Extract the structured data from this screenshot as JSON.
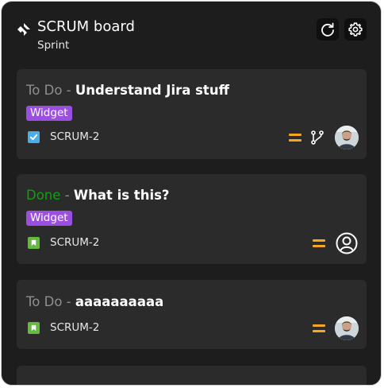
{
  "header": {
    "title": "SCRUM board",
    "subtitle": "Sprint",
    "refresh_icon": "refresh-icon",
    "settings_icon": "gear-icon",
    "logo_icon": "jira-logo-icon"
  },
  "cards": [
    {
      "status": "To Do",
      "separator": " - ",
      "summary": "Understand Jira stuff",
      "label": "Widget",
      "issue_type": "task",
      "key": "SCRUM-2",
      "priority": "medium",
      "has_branch_icon": true,
      "assignee": "avatar"
    },
    {
      "status": "Done",
      "separator": " - ",
      "summary": "What is this?",
      "label": "Widget",
      "issue_type": "story",
      "key": "SCRUM-2",
      "priority": "medium",
      "has_branch_icon": false,
      "assignee": "unassigned"
    },
    {
      "status": "To Do",
      "separator": " - ",
      "summary": "aaaaaaaaaa",
      "label": "",
      "issue_type": "story",
      "key": "SCRUM-2",
      "priority": "medium",
      "has_branch_icon": false,
      "assignee": "avatar"
    }
  ],
  "colors": {
    "background": "#1d1d1d",
    "card": "#2b2b2b",
    "status_todo": "#8f8f8f",
    "status_done": "#0fa00f",
    "label": "#9b4fe0",
    "priority_medium": "#f5a623",
    "task_icon": "#4bade8",
    "story_icon": "#63ba3c"
  }
}
